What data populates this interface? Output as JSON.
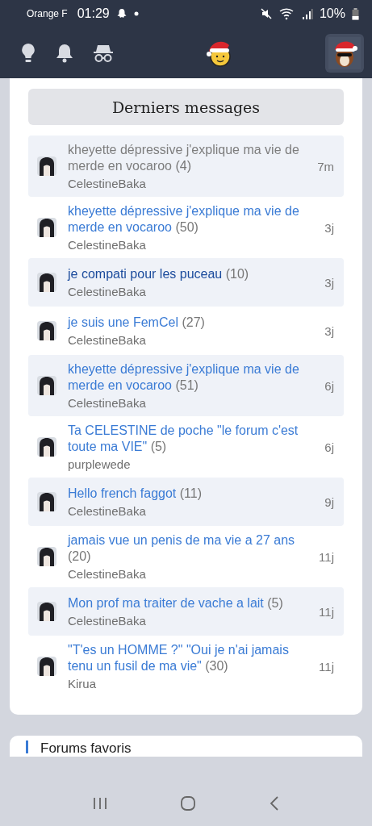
{
  "status_bar": {
    "carrier": "Orange F",
    "time": "01:29",
    "battery": "10%"
  },
  "section": {
    "title": "Derniers messages"
  },
  "topics": [
    {
      "title": "kheyette dépressive j'explique ma vie de merde en vocaroo",
      "count": "(4)",
      "author": "CelestineBaka",
      "age": "7m",
      "kind": "read"
    },
    {
      "title": "kheyette dépressive j'explique ma vie de merde en vocaroo",
      "count": "(50)",
      "author": "CelestineBaka",
      "age": "3j",
      "kind": "new"
    },
    {
      "title": "je compati pour les puceau",
      "count": "(10)",
      "author": "CelestineBaka",
      "age": "3j",
      "kind": "visited"
    },
    {
      "title": "je suis une FemCel",
      "count": "(27)",
      "author": "CelestineBaka",
      "age": "3j",
      "kind": "new"
    },
    {
      "title": "kheyette dépressive j'explique ma vie de merde en vocaroo",
      "count": "(51)",
      "author": "CelestineBaka",
      "age": "6j",
      "kind": "new"
    },
    {
      "title": "Ta CELESTINE de poche \"le forum c'est toute ma VIE\"",
      "count": "(5)",
      "author": "purplewede",
      "age": "6j",
      "kind": "new"
    },
    {
      "title": "Hello french faggot",
      "count": "(11)",
      "author": "CelestineBaka",
      "age": "9j",
      "kind": "new"
    },
    {
      "title": "jamais vue un penis de ma vie a 27 ans",
      "count": "(20)",
      "author": "CelestineBaka",
      "age": "11j",
      "kind": "new"
    },
    {
      "title": "Mon prof ma traiter de vache a lait",
      "count": "(5)",
      "author": "CelestineBaka",
      "age": "11j",
      "kind": "new"
    },
    {
      "title": "\"T'es un HOMME ?\" \"Oui je n'ai jamais tenu un fusil de ma vie\"",
      "count": "(30)",
      "author": "Kirua",
      "age": "11j",
      "kind": "new"
    }
  ],
  "next_section": {
    "title": "Forums favoris"
  }
}
